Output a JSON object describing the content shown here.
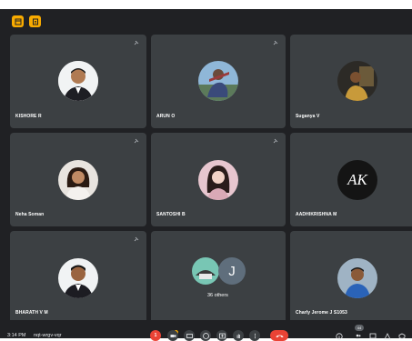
{
  "participants": [
    {
      "name": "KISHORE R"
    },
    {
      "name": "ARUN O"
    },
    {
      "name": "Suganya V"
    },
    {
      "name": "Neha Soman"
    },
    {
      "name": "SANTOSHI B"
    },
    {
      "name": "AADHIKRISHNA M",
      "avatar_text": "AK"
    },
    {
      "name": "BHARATH V M"
    },
    {
      "others_label": "36 others",
      "initial": "J"
    },
    {
      "name": "Charly Jerome J S1053"
    }
  ],
  "bottom_bar": {
    "time": "3:14 PM",
    "meeting_code": "nqt-wrgv-vqr",
    "participants_count": "44",
    "alert_count": "1"
  },
  "colors": {
    "background": "#202124",
    "tile": "#3c4043",
    "accent": "#f9ab00",
    "danger": "#ea4335"
  }
}
